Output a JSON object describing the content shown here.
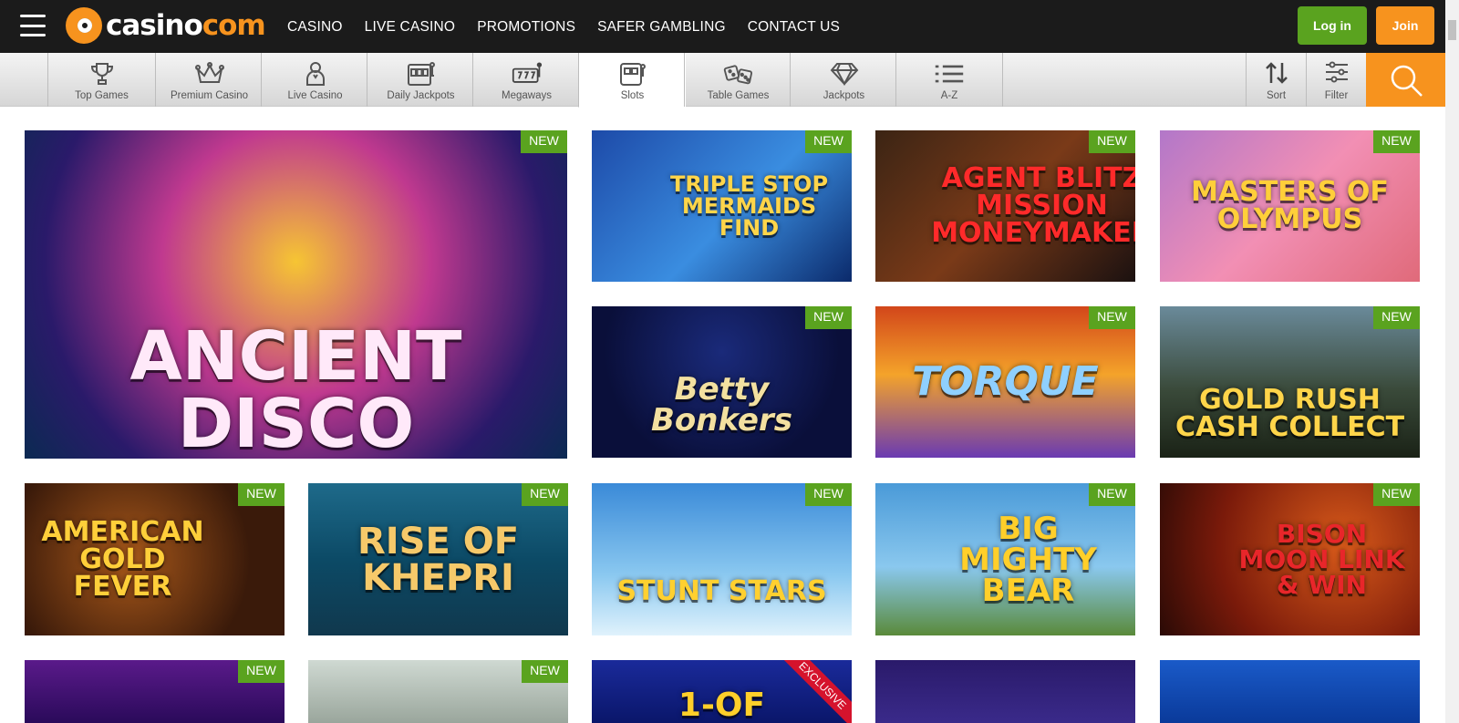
{
  "header": {
    "logo_main": "casino",
    "logo_accent": "com",
    "nav": [
      "CASINO",
      "LIVE CASINO",
      "PROMOTIONS",
      "SAFER GAMBLING",
      "CONTACT US"
    ],
    "login_label": "Log in",
    "join_label": "Join"
  },
  "categories": [
    {
      "label": "Top Games",
      "icon": "trophy-icon"
    },
    {
      "label": "Premium Casino",
      "icon": "crown-icon"
    },
    {
      "label": "Live Casino",
      "icon": "dealer-icon"
    },
    {
      "label": "Daily Jackpots",
      "icon": "jackpot-machine-icon"
    },
    {
      "label": "Megaways",
      "icon": "slot-reels-icon"
    },
    {
      "label": "Slots",
      "icon": "slot-machine-icon",
      "active": true
    },
    {
      "label": "Table Games",
      "icon": "dice-icon"
    },
    {
      "label": "Jackpots",
      "icon": "diamond-icon"
    },
    {
      "label": "A-Z",
      "icon": "list-icon"
    }
  ],
  "tools": {
    "sort_label": "Sort",
    "filter_label": "Filter"
  },
  "games": [
    {
      "title": "Ancient Disco",
      "badge": "NEW"
    },
    {
      "title": "Triple Stop Mermaids Find",
      "badge": "NEW"
    },
    {
      "title": "Agent Blitz Mission Moneymaker",
      "badge": "NEW"
    },
    {
      "title": "Masters of Olympus",
      "badge": "NEW"
    },
    {
      "title": "Betty Bonkers",
      "badge": "NEW"
    },
    {
      "title": "Torque",
      "badge": "NEW"
    },
    {
      "title": "Gold Rush Cash Collect",
      "badge": "NEW"
    },
    {
      "title": "American Gold Fever",
      "badge": "NEW"
    },
    {
      "title": "Rise of Khepri",
      "badge": "NEW"
    },
    {
      "title": "Stunt Stars",
      "badge": "NEW"
    },
    {
      "title": "Big Mighty Bear",
      "badge": "NEW"
    },
    {
      "title": "Bison Moon Link & Win",
      "badge": "NEW"
    },
    {
      "title": "",
      "badge": "NEW"
    },
    {
      "title": "",
      "badge": "NEW"
    },
    {
      "title": "1-OF",
      "badge": "EXCLUSIVE"
    },
    {
      "title": "",
      "badge": ""
    },
    {
      "title": "",
      "badge": ""
    }
  ],
  "colors": {
    "accent": "#f7931e",
    "badge_green": "#5aa31f",
    "exclusive_red": "#d5132d",
    "topbar": "#1b1b1b"
  }
}
